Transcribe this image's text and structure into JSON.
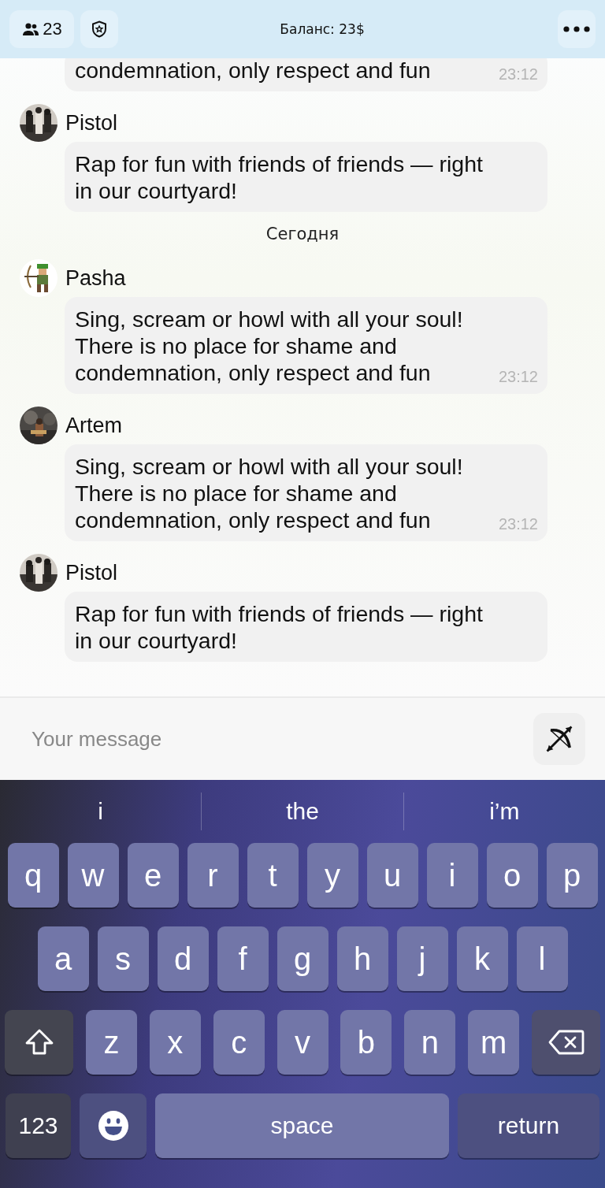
{
  "header": {
    "members_count": "23",
    "balance": "Баланс: 23$"
  },
  "messages": [
    {
      "kind": "message",
      "text": "condemnation, only respect and fun",
      "time": "23:12"
    },
    {
      "kind": "message",
      "author": "Pistol",
      "text": "Rap for fun with friends of friends — right in our courtyard!"
    },
    {
      "kind": "date",
      "text": "Сегодня"
    },
    {
      "kind": "message",
      "author": "Pasha",
      "text": "Sing, scream or howl with all your soul! There is no place for shame and condemnation, only respect and fun",
      "time": "23:12"
    },
    {
      "kind": "message",
      "author": "Artem",
      "text": "Sing, scream or howl with all your soul! There is no place for shame and condemnation, only respect and fun",
      "time": "23:12"
    },
    {
      "kind": "message",
      "author": "Pistol",
      "text": "Rap for fun with friends of friends — right in our courtyard!"
    }
  ],
  "composer": {
    "placeholder": "Your message"
  },
  "keyboard": {
    "suggestions": [
      "i",
      "the",
      "i’m"
    ],
    "rows": [
      {
        "keys": [
          {
            "kind": "letter",
            "label": "q"
          },
          {
            "kind": "letter",
            "label": "w"
          },
          {
            "kind": "letter",
            "label": "e"
          },
          {
            "kind": "letter",
            "label": "r"
          },
          {
            "kind": "letter",
            "label": "t"
          },
          {
            "kind": "letter",
            "label": "y"
          },
          {
            "kind": "letter",
            "label": "u"
          },
          {
            "kind": "letter",
            "label": "i"
          },
          {
            "kind": "letter",
            "label": "o"
          },
          {
            "kind": "letter",
            "label": "p"
          }
        ]
      },
      {
        "keys": [
          {
            "kind": "letter",
            "label": "a"
          },
          {
            "kind": "letter",
            "label": "s"
          },
          {
            "kind": "letter",
            "label": "d"
          },
          {
            "kind": "letter",
            "label": "f"
          },
          {
            "kind": "letter",
            "label": "g"
          },
          {
            "kind": "letter",
            "label": "h"
          },
          {
            "kind": "letter",
            "label": "j"
          },
          {
            "kind": "letter",
            "label": "k"
          },
          {
            "kind": "letter",
            "label": "l"
          }
        ]
      },
      {
        "keys": [
          {
            "kind": "shift"
          },
          {
            "kind": "letter",
            "label": "z"
          },
          {
            "kind": "letter",
            "label": "x"
          },
          {
            "kind": "letter",
            "label": "c"
          },
          {
            "kind": "letter",
            "label": "v"
          },
          {
            "kind": "letter",
            "label": "b"
          },
          {
            "kind": "letter",
            "label": "n"
          },
          {
            "kind": "letter",
            "label": "m"
          },
          {
            "kind": "backspace"
          }
        ]
      },
      {
        "keys": [
          {
            "kind": "numbers",
            "label": "123"
          },
          {
            "kind": "emoji"
          },
          {
            "kind": "space",
            "label": "space"
          },
          {
            "kind": "return",
            "label": "return"
          }
        ]
      }
    ]
  }
}
